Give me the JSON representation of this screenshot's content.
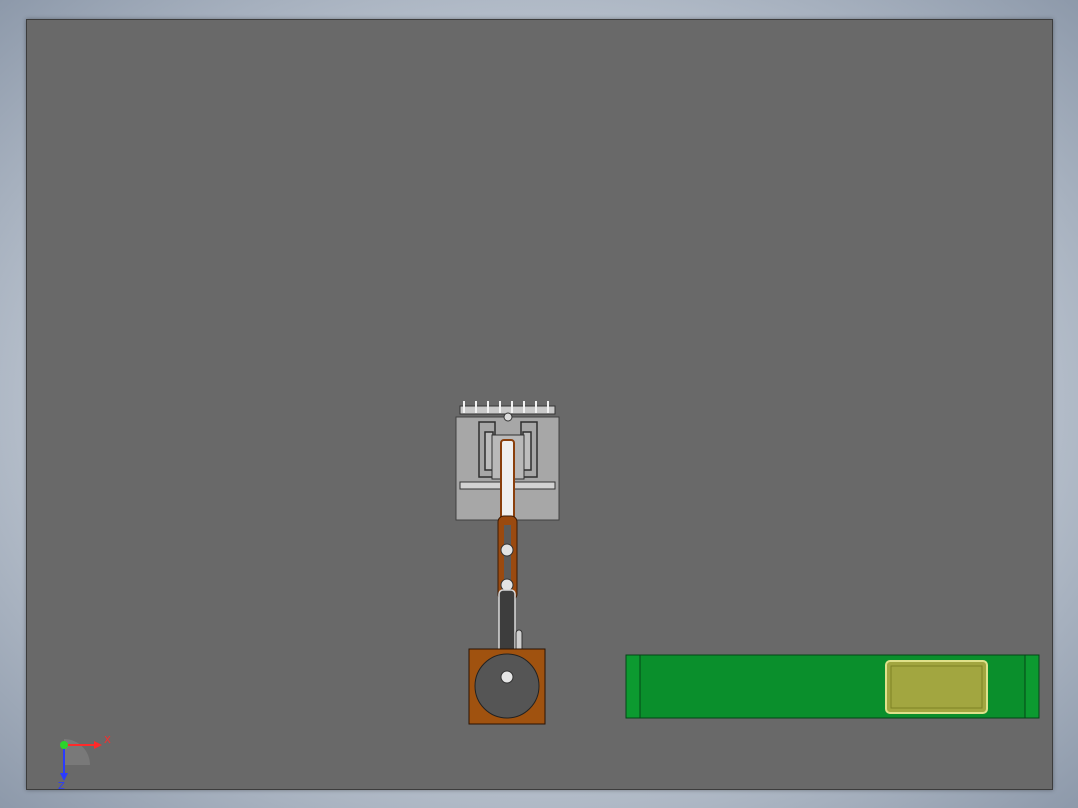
{
  "viewport": {
    "background_color": "#696969",
    "border_color": "#3c3c3c"
  },
  "model": {
    "gripper": {
      "color": "#a7a7a7",
      "detail_color": "#e6e6e6"
    },
    "arm": {
      "link_color": "#9a4a10",
      "joint_color": "#e3e3e3"
    },
    "base": {
      "plate_color": "#a0520f",
      "turntable_color": "#555555"
    },
    "conveyor": {
      "belt_color": "#0a8f2c",
      "edge_color": "#066c1f"
    },
    "part": {
      "color": "#a2a640",
      "highlight_color": "#dfe18a"
    }
  },
  "triad": {
    "x_label": "X",
    "z_label": "Z",
    "x_color": "#ff2a2a",
    "y_color": "#2bd42b",
    "z_color": "#2a3bff"
  }
}
